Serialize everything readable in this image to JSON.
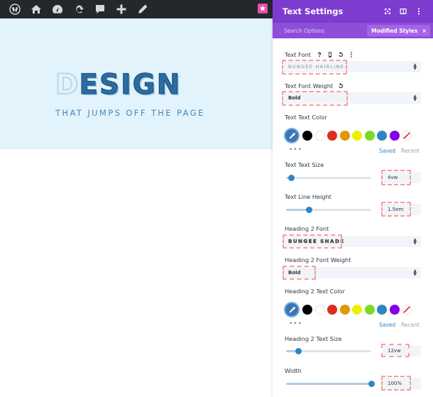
{
  "hero": {
    "heading_first": "D",
    "heading_rest": "ESIGN",
    "tagline": "THAT JUMPS OFF THE PAGE"
  },
  "adminbar": {
    "icons": [
      "wordpress-icon",
      "layers-icon",
      "gauge-icon",
      "refresh-icon",
      "comment-icon",
      "plus-icon",
      "pencil-icon"
    ],
    "accent": "#e84fa8"
  },
  "panel": {
    "title": "Text Settings",
    "header_color": "#7e3bd0",
    "search_placeholder": "Search Options",
    "modified_label": "Modified Styles",
    "modified_close": "×",
    "fields": {
      "text_font": {
        "label": "Text Font",
        "value": "BUNGEE HAIRLINE"
      },
      "text_font_weight": {
        "label": "Text Font Weight",
        "value": "Bold"
      },
      "text_color": {
        "label": "Text Text Color"
      },
      "text_size": {
        "label": "Text Text Size",
        "value": "4vw",
        "level": 0.06
      },
      "line_height": {
        "label": "Text Line Height",
        "value": "1.5em",
        "level": 0.27
      },
      "h2_font": {
        "label": "Heading 2 Font",
        "value": "BUNGEE SHADE"
      },
      "h2_font_weight": {
        "label": "Heading 2 Font Weight",
        "value": "Bold"
      },
      "h2_color": {
        "label": "Heading 2 Text Color"
      },
      "h2_size": {
        "label": "Heading 2 Text Size",
        "value": "12vw",
        "level": 0.14
      },
      "width": {
        "label": "Width",
        "value": "100%",
        "level": 1.0
      }
    },
    "swatches": [
      "#000000",
      "#ffffff",
      "#e02b20",
      "#e09900",
      "#edf000",
      "#7cda24",
      "#2e84c6",
      "#8300e9"
    ],
    "saved_label": "Saved",
    "recent_label": "Recent",
    "more_dots": "•••"
  }
}
